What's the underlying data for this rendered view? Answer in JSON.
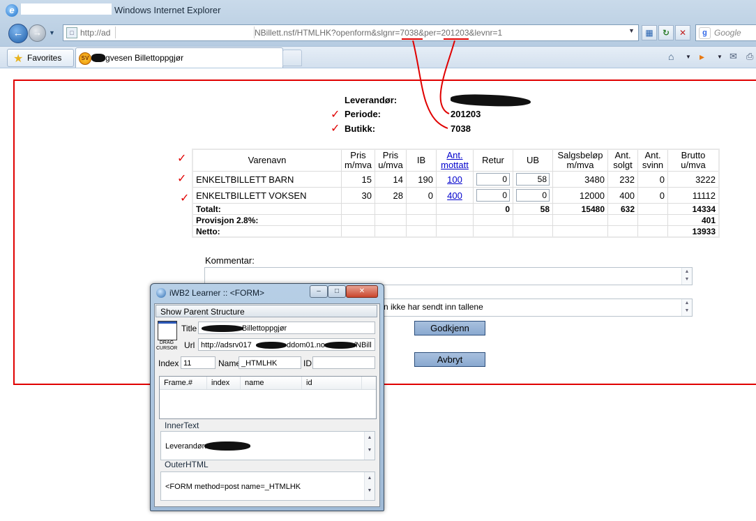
{
  "browser": {
    "title": "Windows Internet Explorer",
    "address": {
      "prefix": "http://ad",
      "rest": "NBillett.nsf/HTMLHK?openform&slgnr=7038&per=201203&levnr=1"
    },
    "search_placeholder": "Google",
    "favorites_label": "Favorites",
    "tab_label": "Vegvesen Billettoppgjør",
    "colors": {
      "chrome": "#b8cde2",
      "accent": "#1e5ea8"
    }
  },
  "page": {
    "info": {
      "leverandor_label": "Leverandør:",
      "periode_label": "Periode:",
      "periode_value": "201203",
      "butikk_label": "Butikk:",
      "butikk_value": "7038"
    },
    "table": {
      "headers": {
        "varenavn": "Varenavn",
        "pris_mva": "Pris m/mva",
        "pris_umva": "Pris u/mva",
        "ib": "IB",
        "ant_mottatt": "Ant. mottatt",
        "retur": "Retur",
        "ub": "UB",
        "salgsbelop": "Salgsbeløp m/mva",
        "ant_solgt": "Ant. solgt",
        "ant_svinn": "Ant. svinn",
        "brutto": "Brutto u/mva"
      },
      "rows": [
        {
          "name": "ENKELTBILLETT BARN",
          "pris_mva": "15",
          "pris_umva": "14",
          "ib": "190",
          "ant_mottatt": "100",
          "retur": "0",
          "ub": "58",
          "salgsbelop": "3480",
          "ant_solgt": "232",
          "ant_svinn": "0",
          "brutto": "3222"
        },
        {
          "name": "ENKELTBILLETT VOKSEN",
          "pris_mva": "30",
          "pris_umva": "28",
          "ib": "0",
          "ant_mottatt": "400",
          "retur": "0",
          "ub": "0",
          "salgsbelop": "12000",
          "ant_solgt": "400",
          "ant_svinn": "0",
          "brutto": "11112"
        }
      ],
      "totals": {
        "label": "Totalt:",
        "retur": "0",
        "ub": "58",
        "salgsbelop": "15480",
        "ant_solgt": "632",
        "brutto": "14334"
      },
      "provisjon": {
        "label": "Provisjon 2.8%:",
        "value": "401"
      },
      "netto": {
        "label": "Netto:",
        "value": "13933"
      }
    },
    "kommentar_label": "Kommentar:",
    "second_field_text": "n ikke har sendt inn tallene",
    "godkjenn_label": "Godkjenn",
    "avbryt_label": "Avbryt",
    "colors": {
      "form_border": "#e00000",
      "link": "#0000cc"
    }
  },
  "annotations": {
    "checkmark": "✓"
  },
  "learner": {
    "title": "iWB2 Learner :: <FORM>",
    "show_parent_label": "Show Parent Structure",
    "drag_label": "DRAG CURSOR",
    "title_label": "Title",
    "title_value": "Billettoppgjør",
    "url_label": "Url",
    "url_value_a": "http://adsrv017",
    "url_value_b": "ddom01.no",
    "url_value_c": "/NBill",
    "index_label": "Index",
    "index_value": "11",
    "name_label": "Name",
    "name_value": "_HTMLHK",
    "id_label": "ID",
    "id_value": "",
    "grid_headers": [
      "Frame.#",
      "index",
      "name",
      "id"
    ],
    "innertext_label": "InnerText",
    "innertext_value": "Leverandør:",
    "outerhtml_label": "OuterHTML",
    "outerhtml_value": "<FORM method=post name=_HTMLHK"
  }
}
